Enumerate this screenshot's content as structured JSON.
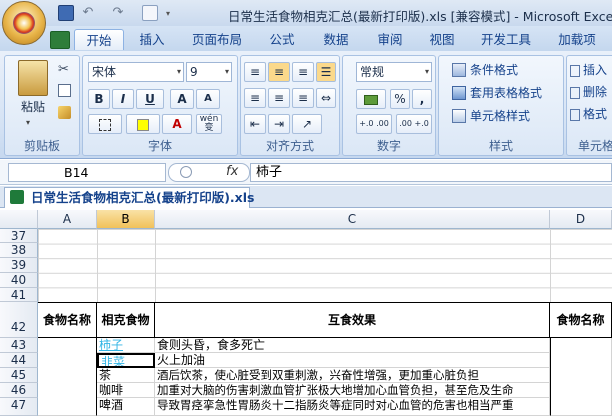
{
  "window": {
    "title": "日常生活食物相克汇总(最新打印版).xls  [兼容模式] - Microsoft Excel"
  },
  "quick_access": [
    "save-icon",
    "undo-icon",
    "redo-icon",
    "print-preview-icon"
  ],
  "tabs": [
    "开始",
    "插入",
    "页面布局",
    "公式",
    "数据",
    "审阅",
    "视图",
    "开发工具",
    "加载项"
  ],
  "ribbon": {
    "clipboard": {
      "label": "剪贴板",
      "paste": "粘贴"
    },
    "font": {
      "label": "字体",
      "name": "宋体",
      "size": "9",
      "bold": "B",
      "italic": "I",
      "underline": "U",
      "grow": "A",
      "shrink": "A",
      "wen": "wén",
      "wen_char": "变"
    },
    "alignment": {
      "label": "对齐方式"
    },
    "number": {
      "label": "数字",
      "format": "常规",
      "percent": "%",
      "comma": ",",
      "inc_decimal": "+.0 .00",
      "dec_decimal": ".00 +.0"
    },
    "styles": {
      "label": "样式",
      "cond_format": "条件格式",
      "table_format": "套用表格格式",
      "cell_styles": "单元格样式"
    },
    "cells": {
      "label": "单元格",
      "insert": "插入",
      "delete": "删除",
      "format": "格式"
    }
  },
  "formula_bar": {
    "name_box": "B14",
    "fx": "fx",
    "value": "柿子"
  },
  "document": {
    "tab": "日常生活食物相克汇总(最新打印版).xls"
  },
  "sheet": {
    "columns": [
      "A",
      "B",
      "C",
      "D"
    ],
    "empty_rows": [
      "37",
      "38",
      "39",
      "40",
      "41"
    ],
    "header_row": {
      "num": "42",
      "a": "食物名称",
      "b": "相克食物",
      "c": "互食效果",
      "d": "食物名称"
    },
    "rows": [
      {
        "num": "43",
        "b": "柿子",
        "c": "食则头昏，食多死亡",
        "b_color": "#33b5e5"
      },
      {
        "num": "44",
        "b": "韭菜",
        "c": "火上加油",
        "b_color": "#33b5e5"
      },
      {
        "num": "45",
        "b": "茶",
        "c": "酒后饮茶，使心脏受到双重刺激，兴奋性增强，更加重心脏负担",
        "b_color": "#000000"
      },
      {
        "num": "46",
        "b": "咖啡",
        "c": "加重对大脑的伤害刺激血管扩张极大地增加心血管负担，甚至危及生命",
        "b_color": "#000000"
      },
      {
        "num": "47",
        "b": "啤酒",
        "c": "导致胃痉挛急性胃肠炎十二指肠炎等症同时对心血管的危害也相当严重",
        "b_color": "#000000"
      }
    ]
  }
}
